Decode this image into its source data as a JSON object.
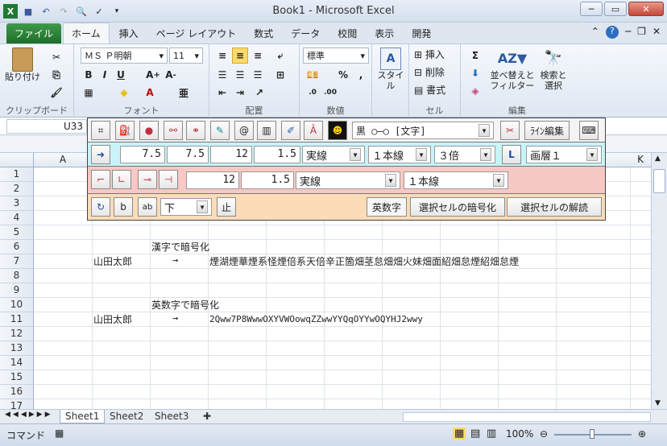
{
  "window": {
    "title": "Book1 - Microsoft Excel"
  },
  "tabs": [
    "ファイル",
    "ホーム",
    "挿入",
    "ページ レイアウト",
    "数式",
    "データ",
    "校閲",
    "表示",
    "開発"
  ],
  "ribbon": {
    "clipboard": {
      "paste": "貼り付け",
      "label": "クリップボード"
    },
    "font": {
      "name": "ＭＳ Ｐ明朝",
      "size": "11",
      "label": "フォント"
    },
    "align": {
      "label": "配置"
    },
    "number": {
      "format": "標準",
      "label": "数値"
    },
    "style": {
      "btn": "スタイル"
    },
    "cells": {
      "insert": "挿入",
      "delete": "削除",
      "format": "書式",
      "label": "セル"
    },
    "edit": {
      "sort": "並べ替えと",
      "sort2": "フィルター",
      "find": "検索と",
      "find2": "選択",
      "label": "編集"
    }
  },
  "namebox": "U33",
  "columns": [
    "A",
    "K"
  ],
  "rows": [
    "1",
    "2",
    "3",
    "4",
    "5",
    "6",
    "7",
    "8",
    "9",
    "10",
    "11",
    "12",
    "13",
    "14",
    "15",
    "16",
    "17"
  ],
  "cells": {
    "r6": "漢字で暗号化",
    "r7a": "山田太郎",
    "r7b": "→",
    "r7c": "煙湖煙華煙系怪煙倍系天倍辛正箇畑茎怠畑畑火妹畑面紹畑怠煙紹畑怠煙",
    "r10": "英数字で暗号化",
    "r11a": "山田太郎",
    "r11b": "→",
    "r11c": "2Qww7P8WwwOXYVWOowqZZwwYYQqOYYwOQYHJ2wwy"
  },
  "sheets": [
    "Sheet1",
    "Sheet2",
    "Sheet3"
  ],
  "status": {
    "mode": "コマンド",
    "zoom": "100%"
  },
  "tool": {
    "color_combo": "黒 ○―○ [文字]",
    "line_edit": "ﾗｲﾝ編集",
    "row2": {
      "v1": "7.5",
      "v2": "7.5",
      "v3": "12",
      "v4": "1.5",
      "style": "実線",
      "lines": "１本線",
      "mult": "３倍",
      "L": "L",
      "layer": "画層１"
    },
    "row3": {
      "v1": "12",
      "v2": "1.5",
      "style": "実線",
      "lines": "１本線"
    },
    "row4": {
      "dir": "下",
      "stop": "止",
      "alnum": "英数字",
      "encrypt": "選択セルの暗号化",
      "decrypt": "選択セルの解読"
    }
  }
}
